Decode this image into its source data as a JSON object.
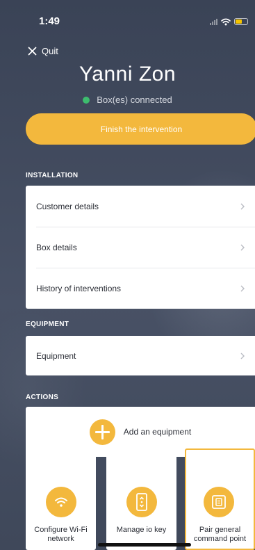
{
  "status_bar": {
    "time": "1:49",
    "icons": [
      "signal-icon",
      "wifi-icon",
      "battery-icon"
    ],
    "battery_color": "#f5c400"
  },
  "header": {
    "quit_label": "Quit",
    "title": "Yanni Zon",
    "connection_status": "Box(es) connected",
    "connection_color": "#3dbd6e"
  },
  "finish_button": {
    "label": "Finish the intervention",
    "color": "#f3b83d"
  },
  "installation": {
    "section_label": "INSTALLATION",
    "items": [
      {
        "label": "Customer details"
      },
      {
        "label": "Box details"
      },
      {
        "label": "History of interventions"
      }
    ]
  },
  "equipment": {
    "section_label": "EQUIPMENT",
    "items": [
      {
        "label": "Equipment"
      }
    ]
  },
  "actions": {
    "section_label": "ACTIONS",
    "add_equipment_label": "Add an equipment",
    "tiles": [
      {
        "label": "Configure Wi-Fi network",
        "icon": "wifi-icon"
      },
      {
        "label": "Manage io key",
        "icon": "remote-key-icon"
      },
      {
        "label": "Pair general command point",
        "icon": "wall-switch-icon"
      }
    ]
  }
}
